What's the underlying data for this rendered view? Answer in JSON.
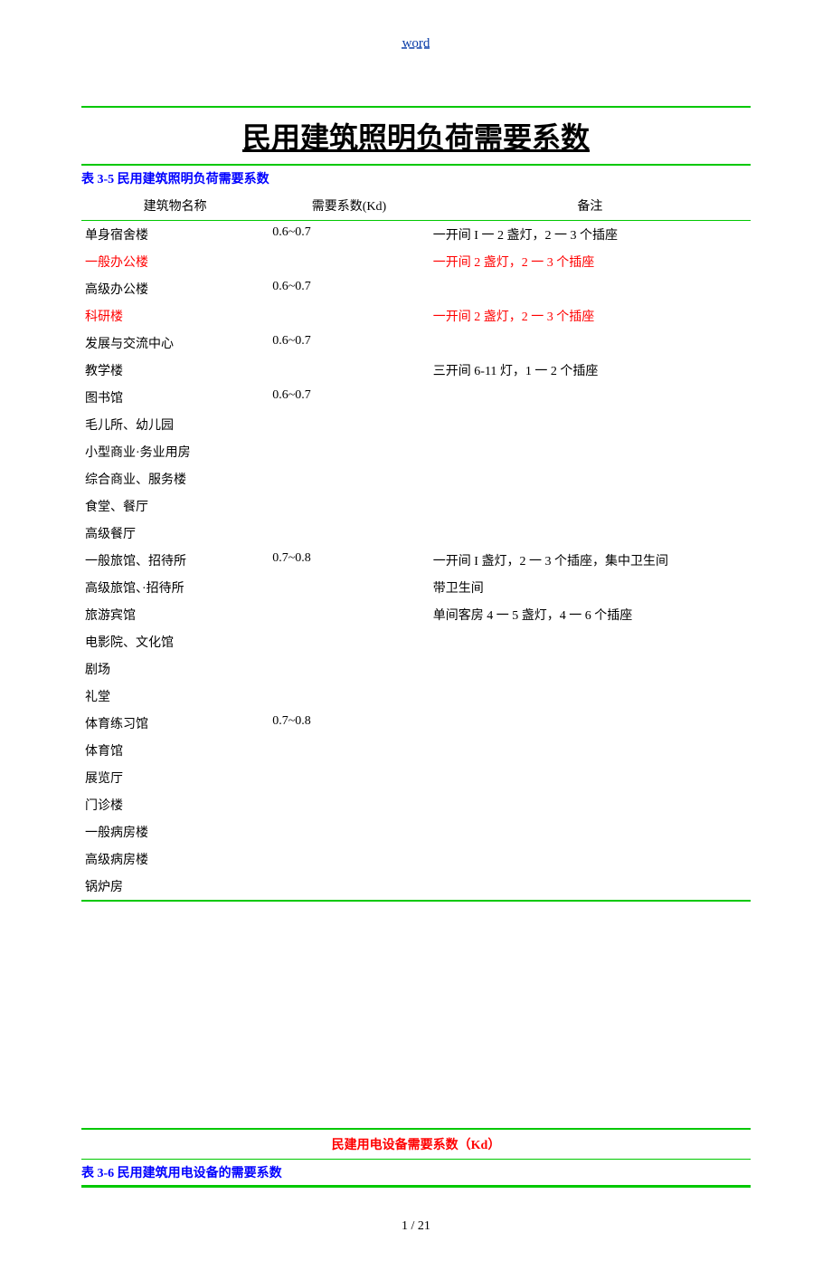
{
  "header_word": "word",
  "main_title": "民用建筑照明负荷需要系数",
  "table1_caption": "表 3-5 民用建筑照明负荷需要系数",
  "table1_headers": {
    "name": "建筑物名称",
    "kd": "需要系数(Kd)",
    "note": "备注"
  },
  "rows": [
    {
      "name": "单身宿舍楼",
      "kd": "0.6~0.7",
      "note": "一开间 I 一 2 盏灯，2 一 3 个插座",
      "red": false
    },
    {
      "name": "一般办公楼",
      "kd": "",
      "note": "一开间 2 盏灯，2 一 3 个插座",
      "red": true
    },
    {
      "name": "高级办公楼",
      "kd": "0.6~0.7",
      "note": "",
      "red": false
    },
    {
      "name": "科研楼",
      "kd": "",
      "note": "一开间 2 盏灯，2 一 3 个插座",
      "red": true
    },
    {
      "name": "发展与交流中心",
      "kd": "0.6~0.7",
      "note": "",
      "red": false
    },
    {
      "name": "教学楼",
      "kd": "",
      "note": "三开间 6-11 灯，1 一 2 个插座",
      "red": false
    },
    {
      "name": "图书馆",
      "kd": "0.6~0.7",
      "note": "",
      "red": false
    },
    {
      "name": "毛儿所、幼儿园",
      "kd": "",
      "note": "",
      "red": false
    },
    {
      "name": "小型商业·务业用房",
      "kd": "",
      "note": "",
      "red": false
    },
    {
      "name": "综合商业、服务楼",
      "kd": "",
      "note": "",
      "red": false
    },
    {
      "name": "食堂、餐厅",
      "kd": "",
      "note": "",
      "red": false
    },
    {
      "name": "高级餐厅",
      "kd": "",
      "note": "",
      "red": false
    },
    {
      "name": "一般旅馆、招待所",
      "kd": "0.7~0.8",
      "note": "一开间 I 盏灯，2 一 3 个插座，集中卫生间",
      "red": false
    },
    {
      "name": "高级旅馆、·招待所",
      "kd": "",
      "note": "带卫生间",
      "red": false
    },
    {
      "name": "旅游宾馆",
      "kd": "",
      "note": "单间客房 4 一 5 盏灯，4 一 6 个插座",
      "red": false
    },
    {
      "name": "电影院、文化馆",
      "kd": "",
      "note": "",
      "red": false
    },
    {
      "name": "剧场",
      "kd": "",
      "note": "",
      "red": false
    },
    {
      "name": "礼堂",
      "kd": "",
      "note": "",
      "red": false
    },
    {
      "name": "体育练习馆",
      "kd": "0.7~0.8",
      "note": "",
      "red": false
    },
    {
      "name": "体育馆",
      "kd": "",
      "note": "",
      "red": false
    },
    {
      "name": "展览厅",
      "kd": "",
      "note": "",
      "red": false
    },
    {
      "name": "门诊楼",
      "kd": "",
      "note": "",
      "red": false
    },
    {
      "name": "一般病房楼",
      "kd": "",
      "note": "",
      "red": false
    },
    {
      "name": "高级病房楼",
      "kd": "",
      "note": "",
      "red": false
    },
    {
      "name": "锅炉房",
      "kd": "",
      "note": "",
      "red": false
    }
  ],
  "section2_title": "民建用电设备需要系数（Kd）",
  "section2_caption": "表 3-6 民用建筑用电设备的需要系数",
  "page_footer": "1 / 21"
}
